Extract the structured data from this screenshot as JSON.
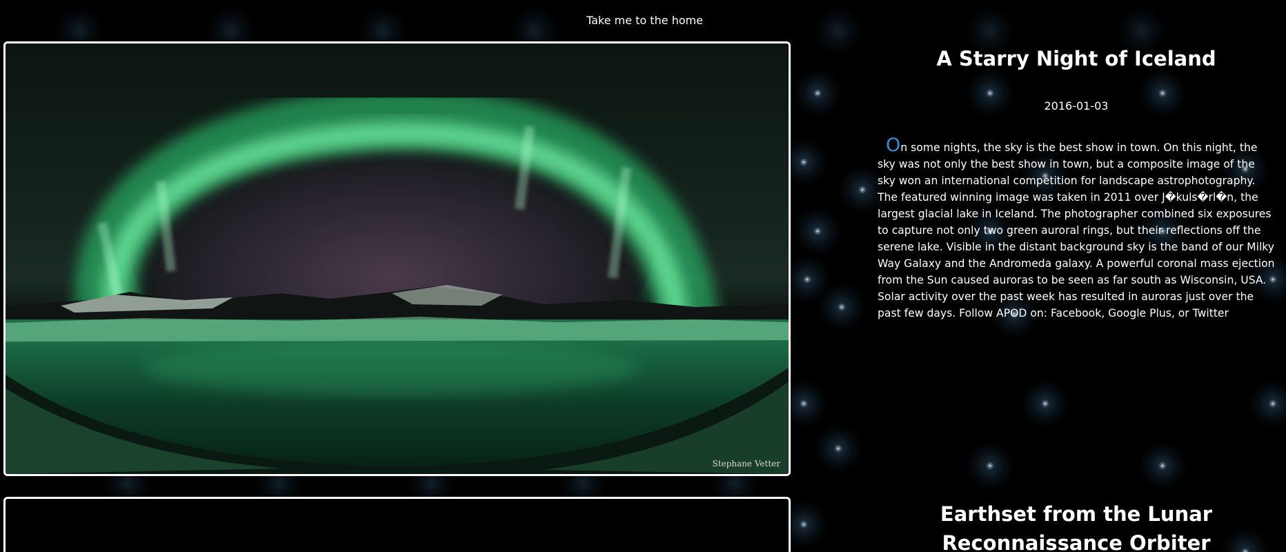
{
  "nav": {
    "home_link": "Take me to the home"
  },
  "posts": [
    {
      "title": "A Starry Night of Iceland",
      "date": "2016-01-03",
      "body_first_letter": "O",
      "body_rest": "n some nights, the sky is the best show in town. On this night, the sky was not only the best show in town, but a composite image of the sky won an international competition for landscape astrophotography. The featured winning image was taken in 2011 over J�kuls�rl�n, the largest glacial lake in Iceland. The photographer combined six exposures to capture not only two green auroral rings, but their reflections off the serene lake. Visible in the distant background sky is the band of our Milky Way Galaxy and the Andromeda galaxy. A powerful coronal mass ejection from the Sun caused auroras to be seen as far south as Wisconsin, USA. Solar activity over the past week has resulted in auroras just over the past few days. Follow APOD on: Facebook, Google Plus, or Twitter",
      "image_credit": "Stephane Vetter"
    },
    {
      "title": "Earthset from the Lunar Reconnaissance Orbiter"
    }
  ],
  "colors": {
    "background": "#000000",
    "text": "#ffffff",
    "dropcap": "#2f8fd8",
    "aurora_green": "#4dff9a"
  }
}
